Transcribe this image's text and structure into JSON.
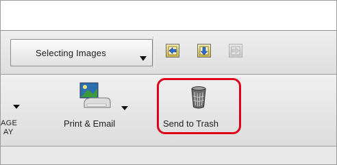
{
  "dropdown": {
    "selected": "Selecting Images"
  },
  "nav_icons": [
    {
      "icon": "arrow-left-icon",
      "enabled": true
    },
    {
      "icon": "arrow-down-icon",
      "enabled": true
    },
    {
      "icon": "arrow-right-icon",
      "enabled": false
    }
  ],
  "toolbar": {
    "partial_label_line1": "AGE",
    "partial_label_line2": "AY",
    "print_label": "Print & Email",
    "trash_label": "Send to Trash"
  },
  "colors": {
    "highlight": "#e0001b",
    "nav_icon_fill": "#c8b44c",
    "nav_arrow": "#2a6bd6"
  }
}
